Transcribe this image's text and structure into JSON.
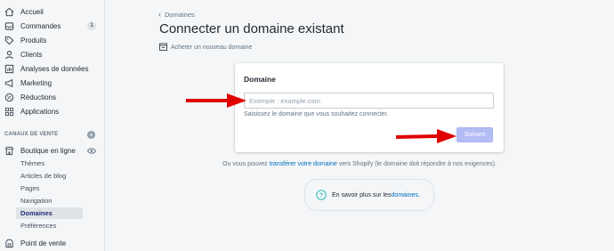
{
  "sidebar": {
    "items": [
      {
        "label": "Accueil",
        "icon": "home-icon"
      },
      {
        "label": "Commandes",
        "icon": "orders-icon",
        "badge": "1"
      },
      {
        "label": "Produits",
        "icon": "tag-icon"
      },
      {
        "label": "Clients",
        "icon": "person-icon"
      },
      {
        "label": "Analyses de données",
        "icon": "analytics-icon"
      },
      {
        "label": "Marketing",
        "icon": "megaphone-icon"
      },
      {
        "label": "Réductions",
        "icon": "discount-icon"
      },
      {
        "label": "Applications",
        "icon": "apps-icon"
      }
    ],
    "channels_title": "CANAUX DE VENTE",
    "channel": {
      "label": "Boutique en ligne",
      "icon": "store-icon"
    },
    "sub_items": [
      {
        "label": "Thèmes"
      },
      {
        "label": "Articles de blog"
      },
      {
        "label": "Pages"
      },
      {
        "label": "Navigation"
      },
      {
        "label": "Domaines",
        "active": true
      },
      {
        "label": "Préférences"
      }
    ],
    "pos": {
      "label": "Point de vente",
      "icon": "pos-icon"
    }
  },
  "breadcrumb": {
    "label": "Domaines"
  },
  "page": {
    "title": "Connecter un domaine existant",
    "secondary_action": "Acheter un nouveau domaine"
  },
  "card": {
    "title": "Domaine",
    "input_placeholder": "Exemple : example.com",
    "input_value": "",
    "help_text": "Saisissez le domaine que vous souhaitez connecter.",
    "next_button": "Suivant"
  },
  "footer": {
    "prefix": "Ou vous pouvez ",
    "link": "transférer votre domaine",
    "suffix": " vers Shopify (le domaine doit répondre à nos exigences)."
  },
  "info": {
    "prefix": "En savoir plus sur les ",
    "link": "domaines",
    "suffix": "."
  },
  "colors": {
    "accent_link": "#006fbb",
    "primary_disabled": "#b3bcf5",
    "annotation_arrow": "#e00000",
    "active_nav": "#202e78"
  }
}
